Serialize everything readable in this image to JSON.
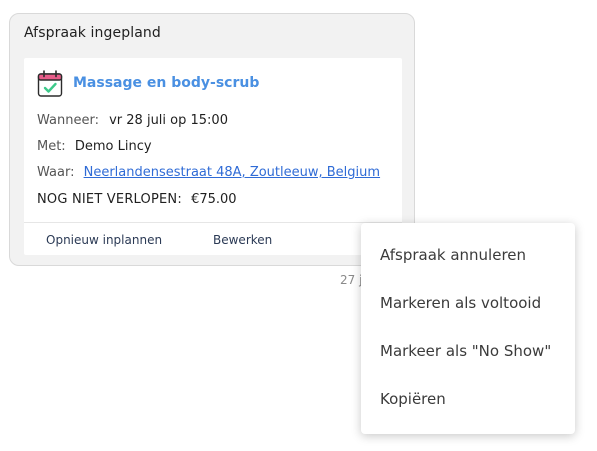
{
  "card": {
    "title": "Afspraak ingepland",
    "service_name": "Massage en body-scrub",
    "when_label": "Wanneer:",
    "when_value": "vr 28 juli op 15:00",
    "with_label": "Met:",
    "with_value": "Demo Lincy",
    "where_label": "Waar:",
    "where_value": "Neerlandensestraat 48A, Zoutleeuw, Belgium",
    "status_label": "NOG NIET VERLOPEN:",
    "price": "€75.00",
    "actions": {
      "reschedule": "Opnieuw inplannen",
      "edit": "Bewerken"
    },
    "icon": "calendar-check-icon"
  },
  "timestamp": "27 j",
  "context_menu": {
    "items": [
      "Afspraak annuleren",
      "Markeren als voltooid",
      "Markeer als \"No Show\"",
      "Kopiëren"
    ]
  },
  "colors": {
    "accent": "#4a90e2",
    "link": "#2f6bd6",
    "check": "#3cc98a",
    "calendar_top": "#e85d8a"
  }
}
